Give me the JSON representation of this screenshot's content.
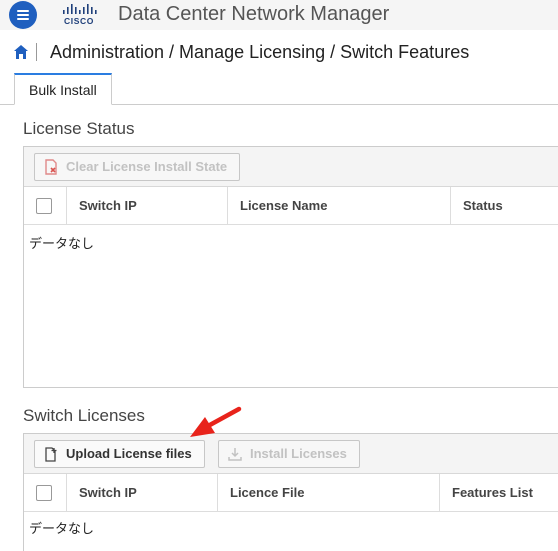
{
  "header": {
    "app_title": "Data Center Network Manager",
    "logo_text": "CISCO",
    "menu_icon": "hamburger-menu-icon"
  },
  "breadcrumb": {
    "home_icon": "home-icon",
    "path": "Administration / Manage Licensing / Switch Features"
  },
  "tabs": [
    {
      "label": "Bulk Install",
      "active": true
    }
  ],
  "license_status": {
    "title": "License Status",
    "toolbar": {
      "clear_label": "Clear License Install State",
      "clear_icon": "clear-state-icon",
      "clear_enabled": false
    },
    "columns": [
      "Switch IP",
      "License Name",
      "Status"
    ],
    "empty_text": "データなし"
  },
  "switch_licenses": {
    "title": "Switch Licenses",
    "toolbar": {
      "upload_label": "Upload License files",
      "upload_icon": "upload-file-icon",
      "upload_enabled": true,
      "install_label": "Install Licenses",
      "install_icon": "download-install-icon",
      "install_enabled": false
    },
    "columns": [
      "Switch IP",
      "Licence File",
      "Features List"
    ],
    "empty_text": "データなし"
  },
  "annotation": {
    "arrow_icon": "red-pointer-arrow-icon",
    "arrow_color": "#e8231b"
  },
  "colors": {
    "brand": "#1f5fbf",
    "tab_accent": "#2a7de1",
    "disabled_text": "#c2c2c2"
  }
}
